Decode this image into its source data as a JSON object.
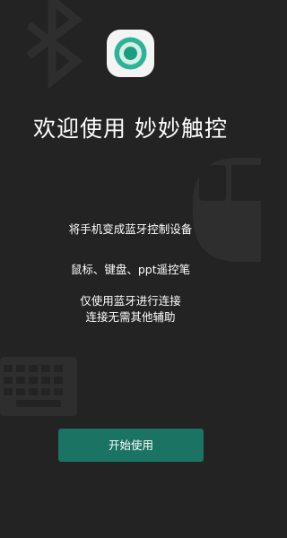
{
  "welcome": {
    "title": "欢迎使用 妙妙触控"
  },
  "description": {
    "line1": "将手机变成蓝牙控制设备",
    "line2": "鼠标、键盘、ppt遥控笔",
    "line3": "仅使用蓝牙进行连接",
    "line4": "连接无需其他辅助"
  },
  "actions": {
    "start_label": "开始使用"
  },
  "icons": {
    "logo": "app-logo-icon",
    "background": [
      "bluetooth-icon",
      "mouse-icon",
      "keyboard-icon"
    ]
  },
  "colors": {
    "background": "#232323",
    "accent": "#1a7363",
    "logo_ring": "#2bb497",
    "watermark": "#2e2e2e"
  }
}
